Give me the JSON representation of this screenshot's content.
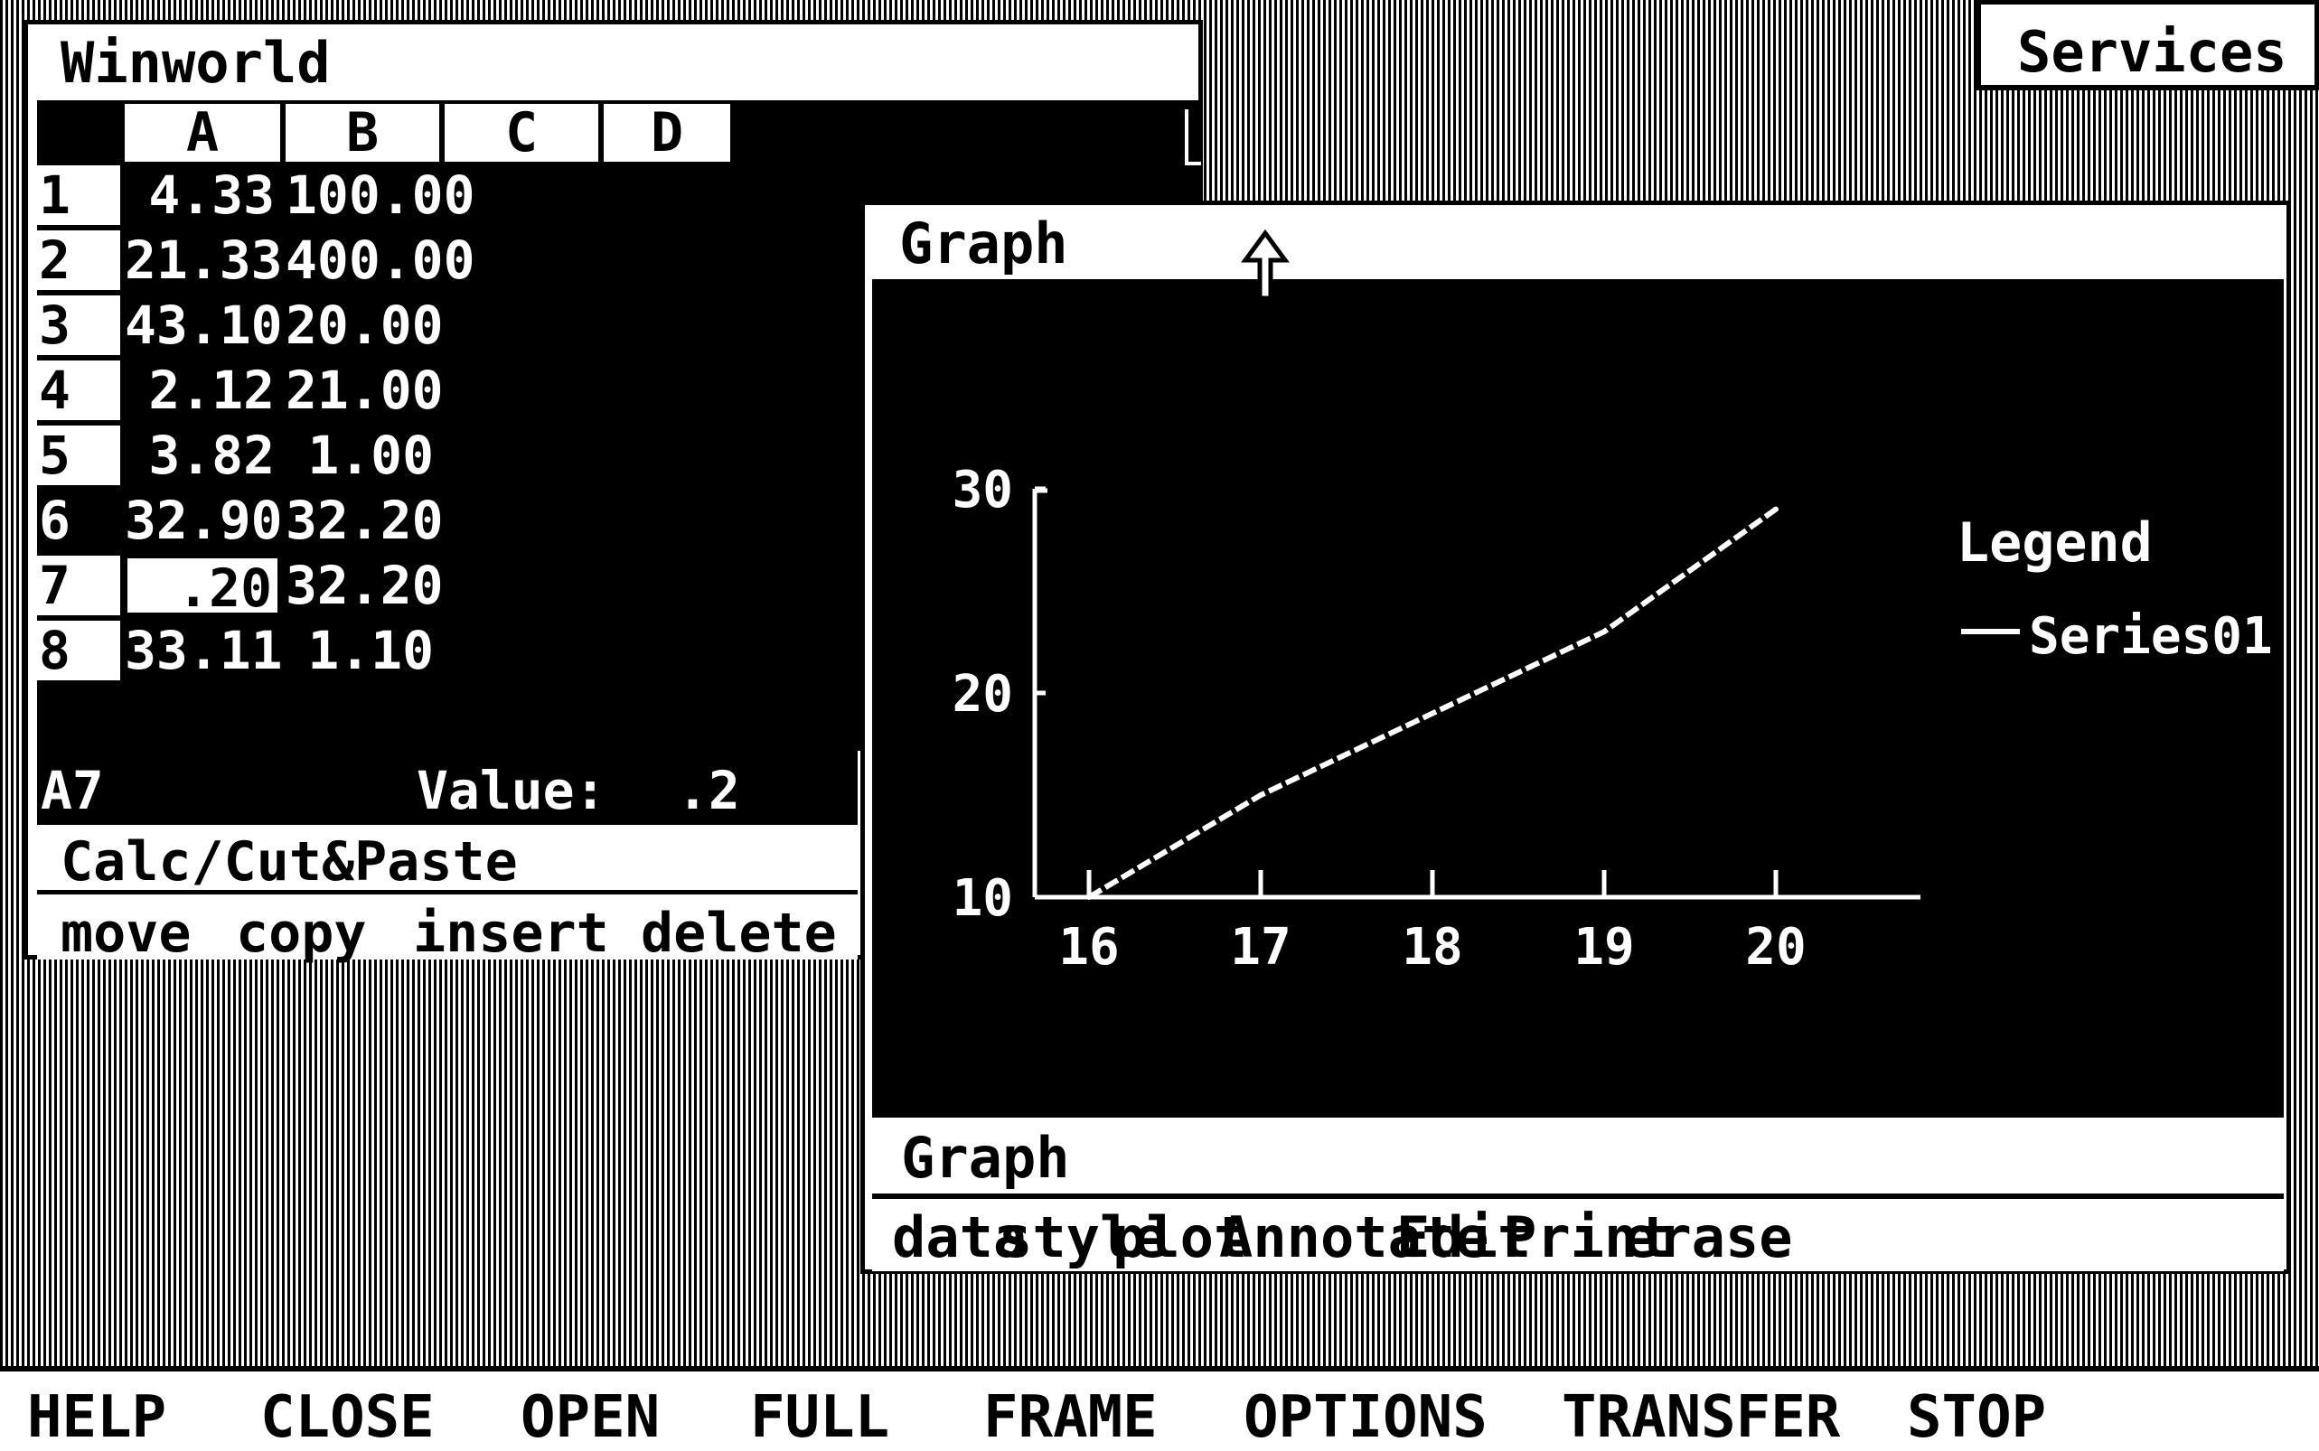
{
  "services": {
    "label": "Services"
  },
  "winworld": {
    "title": "Winworld",
    "columns": [
      "A",
      "B",
      "C",
      "D"
    ],
    "rows": [
      {
        "n": "1",
        "a": "4.33",
        "b": "100.00"
      },
      {
        "n": "2",
        "a": "21.33",
        "b": "400.00"
      },
      {
        "n": "3",
        "a": "43.10",
        "b": "20.00"
      },
      {
        "n": "4",
        "a": "2.12",
        "b": "21.00"
      },
      {
        "n": "5",
        "a": "3.82",
        "b": "1.00"
      },
      {
        "n": "6",
        "a": "32.90",
        "b": "32.20"
      },
      {
        "n": "7",
        "a": ".20",
        "b": "32.20"
      },
      {
        "n": "8",
        "a": "33.11",
        "b": "1.10"
      }
    ],
    "status": {
      "cell_ref": "A7",
      "value_label": "Value:",
      "value": ".2"
    },
    "menu_title": "Calc/Cut&Paste",
    "menu": [
      "move",
      "copy",
      "insert",
      "delete"
    ]
  },
  "graph": {
    "title": "Graph",
    "menu_title": "Graph",
    "menu": [
      "data",
      "style",
      "plot",
      "Annotate",
      "Edit",
      "Print",
      "erase"
    ]
  },
  "chart_data": {
    "type": "line",
    "x": [
      16,
      17,
      18,
      19,
      20
    ],
    "x_ticks": [
      "16",
      "17",
      "18",
      "19",
      "20"
    ],
    "y_ticks": [
      "10",
      "20",
      "30"
    ],
    "ylim": [
      10,
      30
    ],
    "series": [
      {
        "name": "Series01",
        "x": [
          16,
          16.5,
          17,
          17.5,
          18,
          18.5,
          19,
          19.5,
          20
        ],
        "values": [
          10,
          12.5,
          15,
          17,
          19,
          21,
          23,
          26,
          29
        ]
      }
    ],
    "legend": {
      "title": "Legend",
      "placement": "right"
    },
    "grid": false
  },
  "function_bar": [
    "HELP",
    "CLOSE",
    "OPEN",
    "FULL",
    "FRAME",
    "OPTIONS",
    "TRANSFER",
    "STOP"
  ]
}
